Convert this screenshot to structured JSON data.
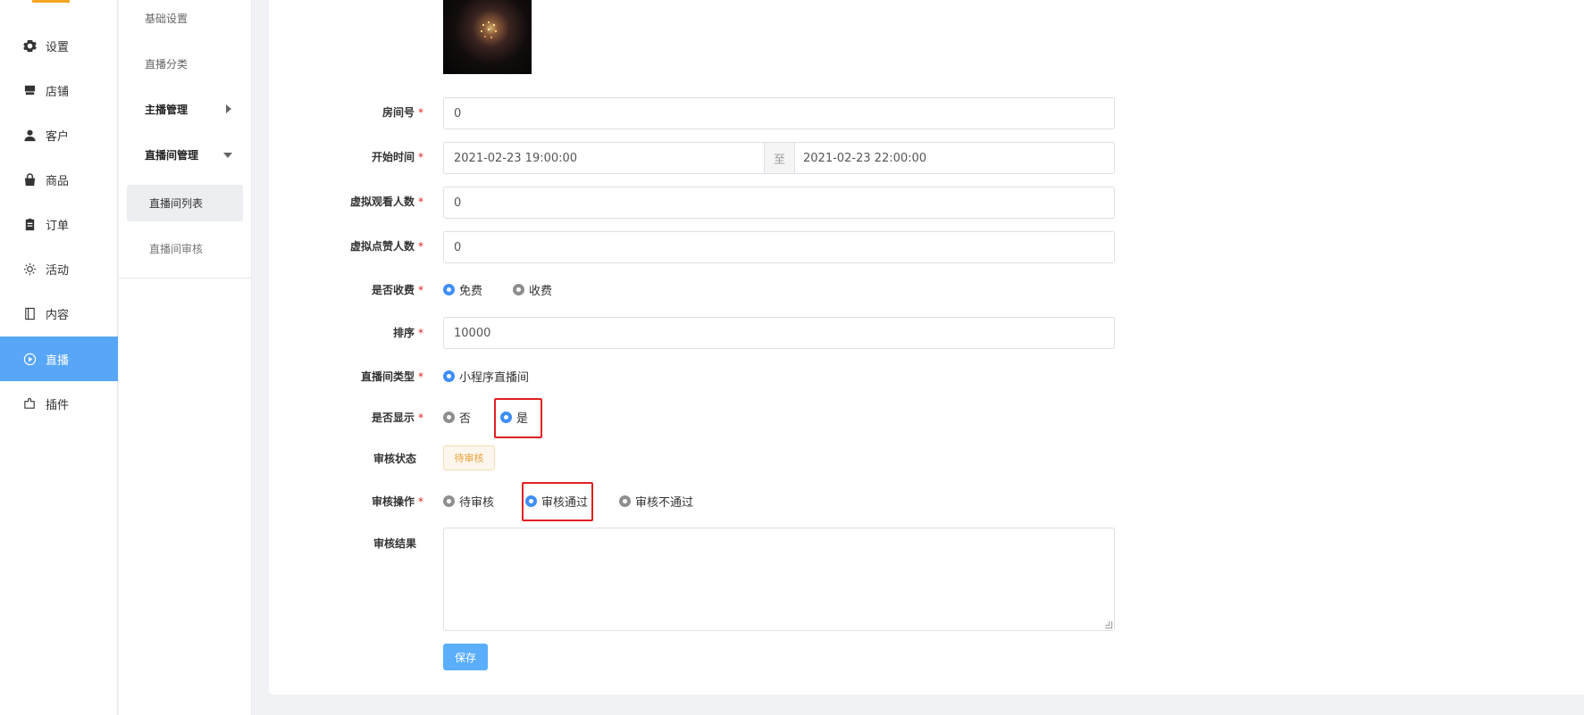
{
  "nav": {
    "items": [
      {
        "label": "设置",
        "icon": "gear-icon"
      },
      {
        "label": "店铺",
        "icon": "store-icon"
      },
      {
        "label": "客户",
        "icon": "user-icon"
      },
      {
        "label": "商品",
        "icon": "shopping-bag-icon"
      },
      {
        "label": "订单",
        "icon": "clipboard-icon"
      },
      {
        "label": "活动",
        "icon": "sun-icon"
      },
      {
        "label": "内容",
        "icon": "book-icon"
      },
      {
        "label": "直播",
        "icon": "play-circle-icon",
        "active": true
      },
      {
        "label": "插件",
        "icon": "plugin-icon"
      }
    ],
    "accent": "#57a6f7"
  },
  "subnav": {
    "items": [
      {
        "label": "基础设置"
      },
      {
        "label": "直播分类"
      },
      {
        "label": "主播管理"
      },
      {
        "label": "直播间管理"
      },
      {
        "label": "直播间列表"
      },
      {
        "label": "直播间审核"
      }
    ]
  },
  "form": {
    "room_no": {
      "label": "房间号",
      "value": "0"
    },
    "start_time": {
      "label": "开始时间",
      "from": "2021-02-23 19:00:00",
      "sep": "至",
      "to": "2021-02-23 22:00:00"
    },
    "virtual_viewers": {
      "label": "虚拟观看人数",
      "value": "0"
    },
    "virtual_likes": {
      "label": "虚拟点赞人数",
      "value": "0"
    },
    "charge": {
      "label": "是否收费",
      "options": [
        "免费",
        "收费"
      ],
      "selected": "免费"
    },
    "sort": {
      "label": "排序",
      "value": "10000"
    },
    "room_type": {
      "label": "直播间类型",
      "options": [
        "小程序直播间"
      ],
      "selected": "小程序直播间"
    },
    "show": {
      "label": "是否显示",
      "options": [
        "否",
        "是"
      ],
      "selected": "是"
    },
    "audit_status": {
      "label": "审核状态",
      "value": "待审核"
    },
    "audit_action": {
      "label": "审核操作",
      "options": [
        "待审核",
        "审核通过",
        "审核不通过"
      ],
      "selected": "审核通过"
    },
    "audit_result": {
      "label": "审核结果",
      "value": ""
    },
    "required_mark": "*",
    "save_label": "保存"
  },
  "colors": {
    "primary": "#3d8ef8",
    "highlight": "#e02020",
    "warning": "#e6a23c"
  }
}
